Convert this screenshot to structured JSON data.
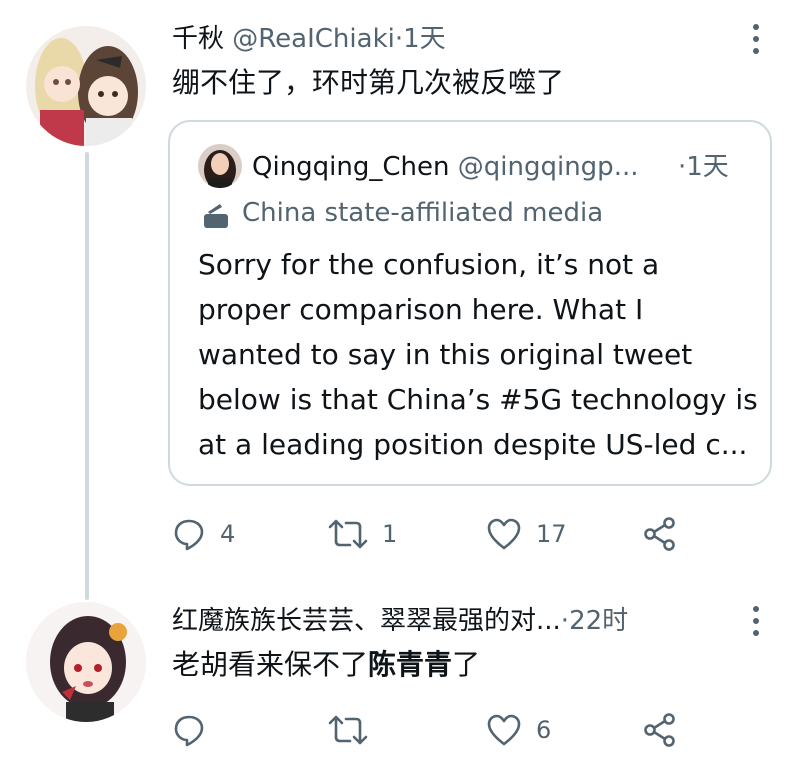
{
  "tweet1": {
    "name": "千秋",
    "handle": "@ReaIChiaki",
    "sep": "·",
    "time": "1天",
    "text": "绷不住了，环时第几次被反噬了",
    "quote": {
      "name": "Qingqing_Chen",
      "handle": "@qingqingp...",
      "sep": "·",
      "time": "1天",
      "label": "China state-affiliated media",
      "lines": [
        "Sorry for the confusion, it’s not a",
        "proper comparison here. What I",
        "wanted to say in this original tweet",
        "below is that China’s #5G technology is",
        "at a leading position despite US-led c..."
      ]
    },
    "counts": {
      "reply": "4",
      "retweet": "1",
      "like": "17"
    }
  },
  "tweet2": {
    "name": "红魔族族长芸芸、翠翠最强的对...",
    "sep": "·",
    "time": "22时",
    "text_plain": "老胡看来保不了",
    "text_bold": "陈青青",
    "text_tail": "了",
    "counts": {
      "reply": "",
      "retweet": "",
      "like": "6"
    }
  },
  "colors": {
    "text": "#0f1419",
    "secondary": "#536471",
    "border": "#cfd9de"
  },
  "icons": [
    "reply-icon",
    "retweet-icon",
    "like-icon",
    "share-icon",
    "more-options-icon",
    "state-media-icon"
  ]
}
